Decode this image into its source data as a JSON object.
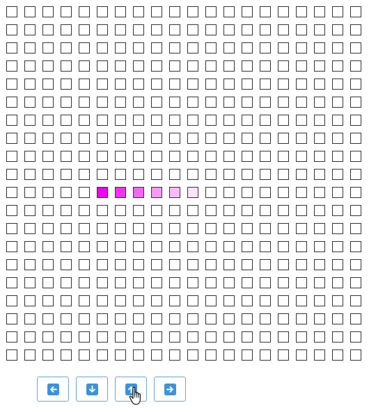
{
  "game": {
    "grid": {
      "rows": 20,
      "cols": 20
    },
    "cell_colors": {
      "empty": "#ffffff",
      "border": "#333333"
    },
    "snake": [
      {
        "row": 10,
        "col": 5,
        "color": "#ee00ee"
      },
      {
        "row": 10,
        "col": 6,
        "color": "#f133f1"
      },
      {
        "row": 10,
        "col": 7,
        "color": "#f466f4"
      },
      {
        "row": 10,
        "col": 8,
        "color": "#f799f7"
      },
      {
        "row": 10,
        "col": 9,
        "color": "#f9bbf9"
      },
      {
        "row": 10,
        "col": 10,
        "color": "#fce4fc"
      }
    ]
  },
  "controls": {
    "accent": "#3a93de",
    "buttons": [
      {
        "direction": "left",
        "icon": "arrow-left-icon"
      },
      {
        "direction": "down",
        "icon": "arrow-down-icon"
      },
      {
        "direction": "up",
        "icon": "arrow-up-icon"
      },
      {
        "direction": "right",
        "icon": "arrow-right-icon"
      }
    ]
  },
  "pointer": {
    "icon": "hand-pointer-icon",
    "over": "up"
  }
}
